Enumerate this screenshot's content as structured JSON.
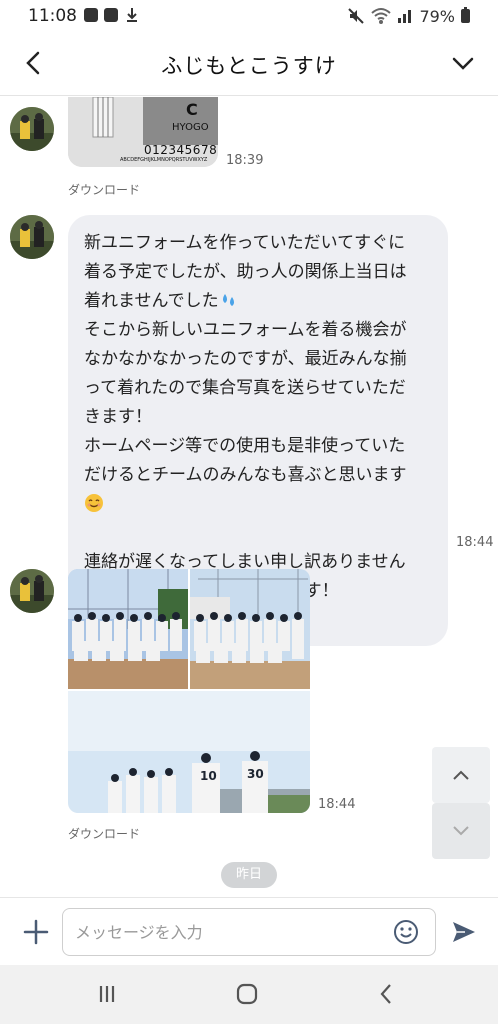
{
  "status_bar": {
    "time": "11:08",
    "battery": "79%",
    "icons": [
      "line-app-icon",
      "notification-icon",
      "download-icon",
      "mute-icon",
      "wifi-icon",
      "signal-icon",
      "battery-icon"
    ]
  },
  "header": {
    "title": "ふじもとこうすけ",
    "back_icon": "back-arrow-icon",
    "menu_icon": "chevron-down-icon"
  },
  "messages": [
    {
      "type": "image",
      "description": "uniform-design-image",
      "image_text": [
        "C",
        "HYOGO",
        "0123456789",
        "ABCDEFGHIJKLMNOPQRSTUVWXYZ"
      ],
      "time": "18:39",
      "download": "ダウンロード"
    },
    {
      "type": "text",
      "lines": [
        "新ユニフォームを作っていただいてすぐに",
        "着る予定でしたが、助っ人の関係上当日は",
        "着れませんでした"
      ],
      "lines2": [
        "そこから新しいユニフォームを着る機会が",
        "なかなかなかったのですが、最近みんな揃",
        "って着れたので集合写真を送らせていただ",
        "きます！",
        "ホームページ等での使用も是非使っていた",
        "だけるとチームのみんなも喜ぶと思います"
      ],
      "lines3": [
        "連絡が遅くなってしまい申し訳ありません",
        "が何枚か送らせていただきます！"
      ],
      "emojis": [
        "sweat-droplets-emoji",
        "smiling-face-emoji"
      ],
      "time": "18:44"
    },
    {
      "type": "image-album",
      "photos": [
        "team-photo-1",
        "team-photo-2",
        "team-huddle-photo"
      ],
      "jersey_numbers": [
        "10",
        "30"
      ],
      "time": "18:44",
      "download": "ダウンロード"
    }
  ],
  "date_divider": "昨日",
  "input": {
    "placeholder": "メッセージを入力",
    "value": ""
  },
  "colors": {
    "bubble": "#eeeff3",
    "accent": "#4a5b74",
    "date_pill": "#d2d4d6"
  }
}
